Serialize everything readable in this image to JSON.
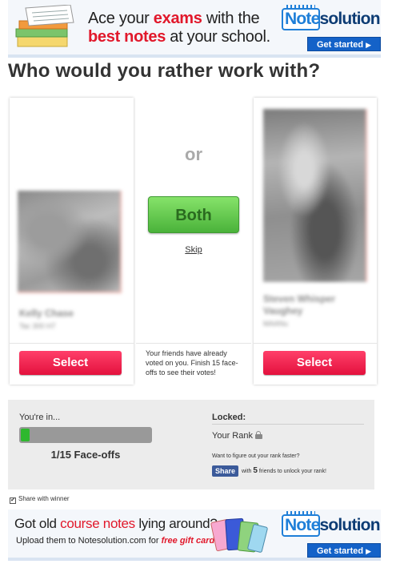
{
  "top_ad": {
    "headline_pre": "Ace your ",
    "headline_red1": "exams",
    "headline_mid": " with the",
    "headline_red2": "best notes",
    "headline_post": " at your school.",
    "logo_note": "Note",
    "logo_solution": "solution",
    "cta": "Get started",
    "cta_arrow": "▶"
  },
  "page": {
    "title": "Who would you rather work with?"
  },
  "left_person": {
    "name": "Kelly Chase",
    "detail": "Tac 300 H7",
    "select_label": "Select"
  },
  "right_person": {
    "name_line1": "Steven Whisper",
    "name_line2": "Vaughey",
    "detail": "MAANu",
    "select_label": "Select"
  },
  "middle": {
    "or_label": "or",
    "both_label": "Both",
    "skip_label": "Skip",
    "friends_note": "Your friends have already voted on you. Finish 15 face-offs to see their votes!"
  },
  "progress": {
    "youre_in": "You're in...",
    "current": 1,
    "total": 15,
    "faceoffs_label": "1/15 Face-offs",
    "locked_label": "Locked:",
    "your_rank": "Your Rank",
    "hint": "Want to figure out your rank faster?",
    "share_label": "Share",
    "share_with": "with",
    "friends_count": "5",
    "share_suffix": "friends to unlock your rank!"
  },
  "share_winner": {
    "label": "Share with winner",
    "checked": true,
    "check_glyph": "✔"
  },
  "bottom_ad": {
    "headline_pre": "Got old ",
    "headline_red": "course notes",
    "headline_post": " lying around?",
    "sub_pre": "Upload them to Notesolution.com for ",
    "sub_red": "free gift cards!",
    "logo_note": "Note",
    "logo_solution": "solution",
    "cta": "Get started",
    "cta_arrow": "▶"
  },
  "icons": {
    "lock": "lock-icon",
    "books": "books-icon",
    "gift_cards": "gift-cards-icon"
  },
  "colors": {
    "brand_blue": "#1f7fd8",
    "brand_red": "#e1182b",
    "select_red": "#ef2350",
    "both_green": "#5fc84a",
    "progress_green": "#2eb82e",
    "facebook_blue": "#3b5a9a"
  }
}
